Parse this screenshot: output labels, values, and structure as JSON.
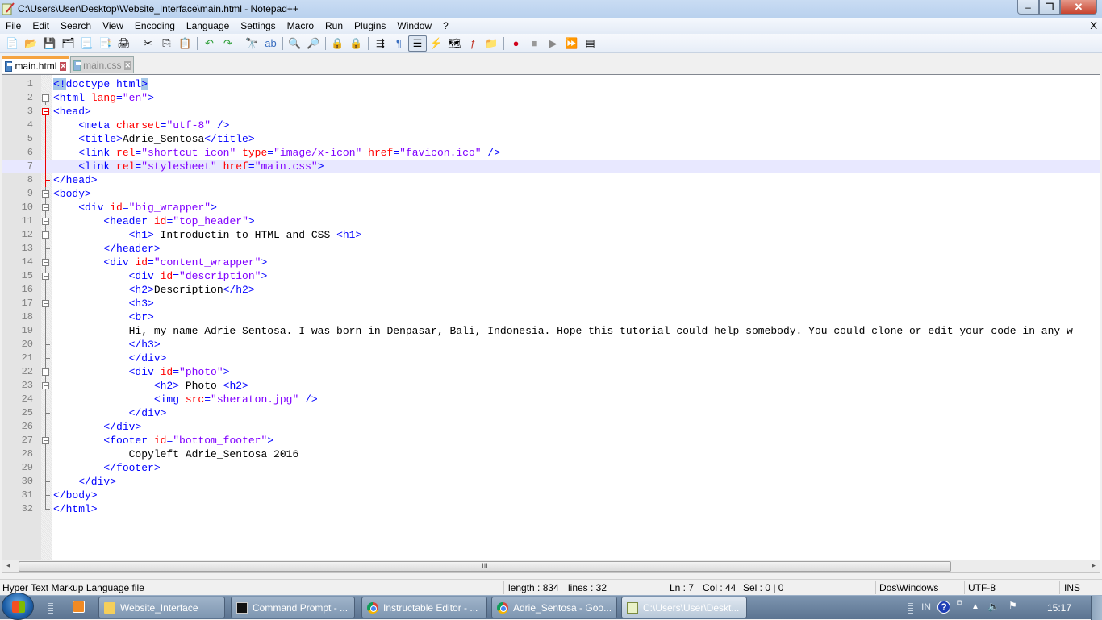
{
  "window": {
    "title": "C:\\Users\\User\\Desktop\\Website_Interface\\main.html - Notepad++",
    "controls": {
      "minimize": "–",
      "maximize": "❐",
      "close": "✕"
    }
  },
  "menu": {
    "items": [
      "File",
      "Edit",
      "Search",
      "View",
      "Encoding",
      "Language",
      "Settings",
      "Macro",
      "Run",
      "Plugins",
      "Window",
      "?"
    ],
    "close_doc": "X"
  },
  "toolbar": {
    "buttons": [
      {
        "name": "new-file-icon",
        "glyph": "📄"
      },
      {
        "name": "open-file-icon",
        "glyph": "📂"
      },
      {
        "name": "save-icon",
        "glyph": "💾"
      },
      {
        "name": "save-all-icon",
        "glyph": "🗂"
      },
      {
        "name": "close-icon",
        "glyph": "📃"
      },
      {
        "name": "close-all-icon",
        "glyph": "📑"
      },
      {
        "name": "print-icon",
        "glyph": "🖨"
      },
      {
        "sep": true
      },
      {
        "name": "cut-icon",
        "glyph": "✂"
      },
      {
        "name": "copy-icon",
        "glyph": "⎘"
      },
      {
        "name": "paste-icon",
        "glyph": "📋"
      },
      {
        "sep": true
      },
      {
        "name": "undo-icon",
        "glyph": "↶"
      },
      {
        "name": "redo-icon",
        "glyph": "↷"
      },
      {
        "sep": true
      },
      {
        "name": "find-icon",
        "glyph": "🔭"
      },
      {
        "name": "replace-icon",
        "glyph": "ab"
      },
      {
        "sep": true
      },
      {
        "name": "zoom-in-icon",
        "glyph": "🔍"
      },
      {
        "name": "zoom-out-icon",
        "glyph": "🔎"
      },
      {
        "sep": true
      },
      {
        "name": "sync-vertical-icon",
        "glyph": "🔒"
      },
      {
        "name": "sync-horizontal-icon",
        "glyph": "🔒"
      },
      {
        "sep": true
      },
      {
        "name": "word-wrap-icon",
        "glyph": "⇶"
      },
      {
        "name": "show-all-chars-icon",
        "glyph": "¶"
      },
      {
        "name": "indent-guide-icon",
        "glyph": "☰",
        "active": true
      },
      {
        "name": "udl-icon",
        "glyph": "⚡"
      },
      {
        "name": "doc-map-icon",
        "glyph": "🗺"
      },
      {
        "name": "function-list-icon",
        "glyph": "ƒ"
      },
      {
        "name": "folder-workspace-icon",
        "glyph": "📁"
      },
      {
        "sep": true
      },
      {
        "name": "record-macro-icon",
        "glyph": "●"
      },
      {
        "name": "stop-macro-icon",
        "glyph": "■"
      },
      {
        "name": "play-macro-icon",
        "glyph": "▶"
      },
      {
        "name": "run-macro-multiple-icon",
        "glyph": "⏩"
      },
      {
        "name": "save-macro-icon",
        "glyph": "▤"
      }
    ]
  },
  "tabs": [
    {
      "label": "main.html",
      "active": true
    },
    {
      "label": "main.css",
      "active": false
    }
  ],
  "editor": {
    "current_line": 7,
    "lines": [
      {
        "n": "1",
        "fold": "",
        "tokens": [
          [
            "hl",
            "<!"
          ],
          [
            "t",
            "doctype html"
          ],
          [
            "hl",
            ">"
          ]
        ]
      },
      {
        "n": "2",
        "fold": "box",
        "tokens": [
          [
            "t",
            "<html "
          ],
          [
            "a",
            "lang"
          ],
          [
            "t",
            "="
          ],
          [
            "v",
            "\"en\""
          ],
          [
            "t",
            ">"
          ]
        ]
      },
      {
        "n": "3",
        "fold": "boxred",
        "tokens": [
          [
            "t",
            "<head>"
          ]
        ]
      },
      {
        "n": "4",
        "fold": "vred",
        "tokens": [
          [
            "t",
            "    <meta "
          ],
          [
            "a",
            "charset"
          ],
          [
            "t",
            "="
          ],
          [
            "v",
            "\"utf-8\""
          ],
          [
            "t",
            " />"
          ]
        ]
      },
      {
        "n": "5",
        "fold": "vred",
        "tokens": [
          [
            "t",
            "    <title>"
          ],
          [
            "tx",
            "Adrie_Sentosa"
          ],
          [
            "t",
            "</title>"
          ]
        ]
      },
      {
        "n": "6",
        "fold": "vred",
        "tokens": [
          [
            "t",
            "    <link "
          ],
          [
            "a",
            "rel"
          ],
          [
            "t",
            "="
          ],
          [
            "v",
            "\"shortcut icon\""
          ],
          [
            "t",
            " "
          ],
          [
            "a",
            "type"
          ],
          [
            "t",
            "="
          ],
          [
            "v",
            "\"image/x-icon\""
          ],
          [
            "t",
            " "
          ],
          [
            "a",
            "href"
          ],
          [
            "t",
            "="
          ],
          [
            "v",
            "\"favicon.ico\""
          ],
          [
            "t",
            " />"
          ]
        ]
      },
      {
        "n": "7",
        "fold": "vred",
        "tokens": [
          [
            "t",
            "    <link "
          ],
          [
            "a",
            "rel"
          ],
          [
            "t",
            "="
          ],
          [
            "v",
            "\"stylesheet\""
          ],
          [
            "t",
            " "
          ],
          [
            "a",
            "href"
          ],
          [
            "t",
            "="
          ],
          [
            "v",
            "\"main.css\""
          ],
          [
            "t",
            ">"
          ]
        ]
      },
      {
        "n": "8",
        "fold": "endred",
        "tokens": [
          [
            "t",
            "</head>"
          ]
        ]
      },
      {
        "n": "9",
        "fold": "box",
        "tokens": [
          [
            "t",
            "<body>"
          ]
        ]
      },
      {
        "n": "10",
        "fold": "box",
        "tokens": [
          [
            "t",
            "    <div "
          ],
          [
            "a",
            "id"
          ],
          [
            "t",
            "="
          ],
          [
            "v",
            "\"big_wrapper\""
          ],
          [
            "t",
            ">"
          ]
        ]
      },
      {
        "n": "11",
        "fold": "box",
        "tokens": [
          [
            "t",
            "        <header "
          ],
          [
            "a",
            "id"
          ],
          [
            "t",
            "="
          ],
          [
            "v",
            "\"top_header\""
          ],
          [
            "t",
            ">"
          ]
        ]
      },
      {
        "n": "12",
        "fold": "box",
        "tokens": [
          [
            "t",
            "            <h1>"
          ],
          [
            "tx",
            " Introductin to HTML and CSS "
          ],
          [
            "t",
            "<h1>"
          ]
        ]
      },
      {
        "n": "13",
        "fold": "end",
        "tokens": [
          [
            "t",
            "        </header>"
          ]
        ]
      },
      {
        "n": "14",
        "fold": "box",
        "tokens": [
          [
            "t",
            "        <div "
          ],
          [
            "a",
            "id"
          ],
          [
            "t",
            "="
          ],
          [
            "v",
            "\"content_wrapper\""
          ],
          [
            "t",
            ">"
          ]
        ]
      },
      {
        "n": "15",
        "fold": "box",
        "tokens": [
          [
            "t",
            "            <div "
          ],
          [
            "a",
            "id"
          ],
          [
            "t",
            "="
          ],
          [
            "v",
            "\"description\""
          ],
          [
            "t",
            ">"
          ]
        ]
      },
      {
        "n": "16",
        "fold": "v",
        "tokens": [
          [
            "t",
            "            <h2>"
          ],
          [
            "tx",
            "Description"
          ],
          [
            "t",
            "</h2>"
          ]
        ]
      },
      {
        "n": "17",
        "fold": "box",
        "tokens": [
          [
            "t",
            "            <h3>"
          ]
        ]
      },
      {
        "n": "18",
        "fold": "v",
        "tokens": [
          [
            "t",
            "            <br>"
          ]
        ]
      },
      {
        "n": "19",
        "fold": "v",
        "tokens": [
          [
            "tx",
            "            Hi, my name Adrie Sentosa. I was born in Denpasar, Bali, Indonesia. Hope this tutorial could help somebody. You could clone or edit your code in any w"
          ]
        ]
      },
      {
        "n": "20",
        "fold": "end",
        "tokens": [
          [
            "t",
            "            </h3>"
          ]
        ]
      },
      {
        "n": "21",
        "fold": "end",
        "tokens": [
          [
            "t",
            "            </div>"
          ]
        ]
      },
      {
        "n": "22",
        "fold": "box",
        "tokens": [
          [
            "t",
            "            <div "
          ],
          [
            "a",
            "id"
          ],
          [
            "t",
            "="
          ],
          [
            "v",
            "\"photo\""
          ],
          [
            "t",
            ">"
          ]
        ]
      },
      {
        "n": "23",
        "fold": "box",
        "tokens": [
          [
            "t",
            "                <h2>"
          ],
          [
            "tx",
            " Photo "
          ],
          [
            "t",
            "<h2>"
          ]
        ]
      },
      {
        "n": "24",
        "fold": "v",
        "tokens": [
          [
            "t",
            "                <img "
          ],
          [
            "a",
            "src"
          ],
          [
            "t",
            "="
          ],
          [
            "v",
            "\"sheraton.jpg\""
          ],
          [
            "t",
            " />"
          ]
        ]
      },
      {
        "n": "25",
        "fold": "end",
        "tokens": [
          [
            "t",
            "            </div>"
          ]
        ]
      },
      {
        "n": "26",
        "fold": "end",
        "tokens": [
          [
            "t",
            "        </div>"
          ]
        ]
      },
      {
        "n": "27",
        "fold": "box",
        "tokens": [
          [
            "t",
            "        <footer "
          ],
          [
            "a",
            "id"
          ],
          [
            "t",
            "="
          ],
          [
            "v",
            "\"bottom_footer\""
          ],
          [
            "t",
            ">"
          ]
        ]
      },
      {
        "n": "28",
        "fold": "v",
        "tokens": [
          [
            "tx",
            "            Copyleft Adrie_Sentosa 2016"
          ]
        ]
      },
      {
        "n": "29",
        "fold": "end",
        "tokens": [
          [
            "t",
            "        </footer>"
          ]
        ]
      },
      {
        "n": "30",
        "fold": "end",
        "tokens": [
          [
            "t",
            "    </div>"
          ]
        ]
      },
      {
        "n": "31",
        "fold": "end",
        "tokens": [
          [
            "t",
            "</body>"
          ]
        ]
      },
      {
        "n": "32",
        "fold": "end",
        "tokens": [
          [
            "t",
            "</html>"
          ]
        ]
      }
    ]
  },
  "scrollbar": {
    "left_arrow": "◂",
    "right_arrow": "▸",
    "grip": "III"
  },
  "status": {
    "file_type": "Hyper Text Markup Language file",
    "length": "length : 834",
    "lines": "lines : 32",
    "ln": "Ln : 7",
    "col": "Col : 44",
    "sel": "Sel : 0 | 0",
    "eol": "Dos\\Windows",
    "encoding": "UTF-8",
    "mode": "INS"
  },
  "taskbar": {
    "tasks": [
      {
        "label": "Website_Interface",
        "icon": "folder"
      },
      {
        "label": "Command Prompt - ...",
        "icon": "cmd"
      },
      {
        "label": "Instructable Editor - ...",
        "icon": "chrome"
      },
      {
        "label": "Adrie_Sentosa - Goo...",
        "icon": "chrome"
      },
      {
        "label": "C:\\Users\\User\\Deskt...",
        "icon": "npp",
        "active": true
      }
    ],
    "tray": {
      "lang": "IN",
      "help": "?",
      "clock": "15:17"
    }
  }
}
